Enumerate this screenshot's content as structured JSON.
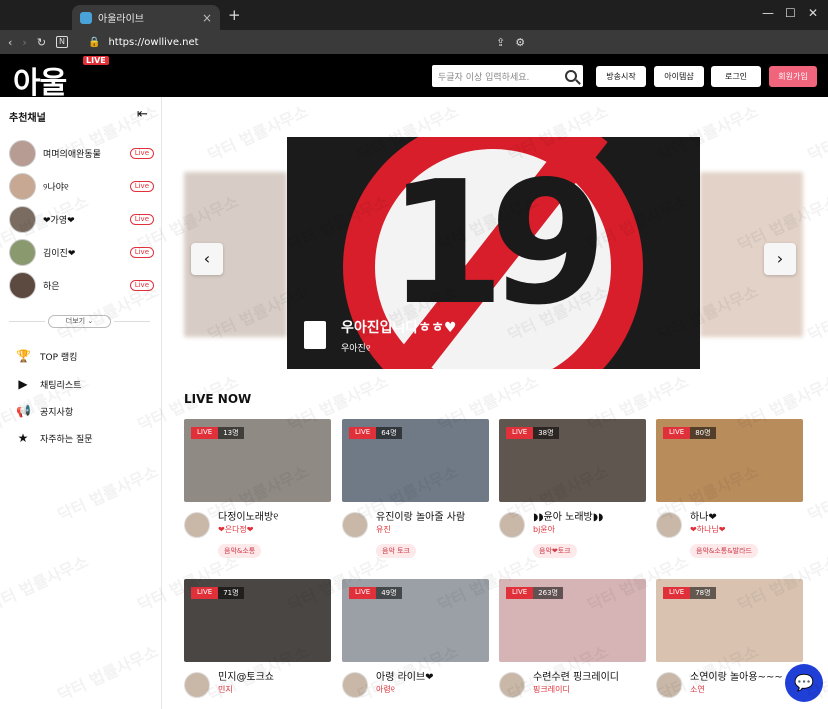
{
  "browser": {
    "tab_title": "아울라이브",
    "url": "https://owllive.net",
    "tab_close": "×",
    "new_tab": "+",
    "window_controls": [
      "—",
      "☐",
      "✕"
    ]
  },
  "header": {
    "logo_text": "아울",
    "logo_badge": "LIVE",
    "search_placeholder": "두글자 이상 입력하세요.",
    "buttons": [
      "방송시작",
      "아이템샵",
      "로그인",
      "회원가입"
    ]
  },
  "sidebar": {
    "title": "추천채널",
    "collapse_icon": "⇤",
    "channels": [
      {
        "name": "며며의애완동물",
        "badge": "Live"
      },
      {
        "name": "୨나야୧",
        "badge": "Live"
      },
      {
        "name": "❤가영❤",
        "badge": "Live"
      },
      {
        "name": "김이진❤",
        "badge": "Live"
      },
      {
        "name": "하은",
        "badge": "Live"
      }
    ],
    "more_label": "더보기 ⌄",
    "menu": [
      {
        "icon": "trophy-icon",
        "label": "TOP 랭킹"
      },
      {
        "icon": "playlist-icon",
        "label": "채팅리스트"
      },
      {
        "icon": "megaphone-icon",
        "label": "공지사항"
      },
      {
        "icon": "faq-icon",
        "label": "자주하는 질문"
      }
    ]
  },
  "hero": {
    "number": "19",
    "title": "우아진입니다ㅎㅎ♥",
    "subtitle": "우아진୧",
    "prev": "‹",
    "next": "›"
  },
  "live_now": {
    "title": "LIVE NOW",
    "cards": [
      {
        "badge": "LIVE",
        "count": "13명",
        "title": "다정이노래방୧",
        "user": "❤은다정❤",
        "tag": "음악&소통",
        "thumb": "#8f8a84"
      },
      {
        "badge": "LIVE",
        "count": "64명",
        "title": "유진이랑 놀아줄 사람",
        "user": "유진",
        "tag": "음악 토크",
        "thumb": "#6f7a86"
      },
      {
        "badge": "LIVE",
        "count": "38명",
        "title": "◗◗윤아 노래방◗◗",
        "user": "bj윤아",
        "tag": "음악❤토크",
        "thumb": "#5f5650"
      },
      {
        "badge": "LIVE",
        "count": "80명",
        "title": "하나❤",
        "user": "❤하나님❤",
        "tag": "음악&소통&발라드",
        "thumb": "#b98c5c"
      },
      {
        "badge": "LIVE",
        "count": "71명",
        "title": "민지@토크쇼",
        "user": "민지",
        "tag": "",
        "thumb": "#4a4644"
      },
      {
        "badge": "LIVE",
        "count": "49명",
        "title": "아령 라이브❤",
        "user": "아령୧",
        "tag": "",
        "thumb": "#9aa0a6"
      },
      {
        "badge": "LIVE",
        "count": "263명",
        "title": "수련수련 핑크레이디",
        "user": "핑크레이디",
        "tag": "",
        "thumb": "#d6b4b6"
      },
      {
        "badge": "LIVE",
        "count": "78명",
        "title": "소연이랑 놀아용~~~",
        "user": "소연",
        "tag": "",
        "thumb": "#d9c3b0"
      }
    ]
  },
  "chat_icon": "💬",
  "watermark": "닥터 법률사무소"
}
